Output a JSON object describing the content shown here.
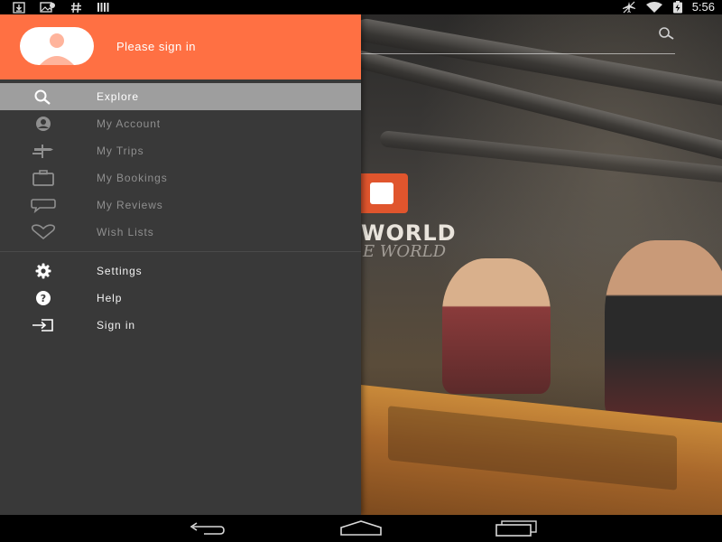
{
  "status_bar": {
    "left_icons": [
      "download-icon",
      "image-icon",
      "hash-icon",
      "barcode-icon"
    ],
    "right_icons": [
      "airplane-mode-icon",
      "wifi-icon",
      "battery-charging-icon"
    ],
    "time": "5:56"
  },
  "drawer": {
    "header": {
      "signin_prompt": "Please sign in",
      "background_color": "#ff7043"
    },
    "items": [
      {
        "label": "Explore",
        "icon": "search-icon",
        "active": true
      },
      {
        "label": "My Account",
        "icon": "account-icon",
        "active": false
      },
      {
        "label": "My Trips",
        "icon": "signpost-icon",
        "active": false
      },
      {
        "label": "My Bookings",
        "icon": "briefcase-icon",
        "active": false
      },
      {
        "label": "My Reviews",
        "icon": "speech-bubble-icon",
        "active": false
      },
      {
        "label": "Wish Lists",
        "icon": "heart-icon",
        "active": false
      }
    ],
    "secondary_items": [
      {
        "label": "Settings",
        "icon": "gear-icon"
      },
      {
        "label": "Help",
        "icon": "help-icon"
      },
      {
        "label": "Sign in",
        "icon": "sign-in-icon"
      }
    ]
  },
  "background": {
    "wall_text": "WORLD",
    "wall_text_script": "E WORLD"
  },
  "nav_bar": {
    "buttons": [
      "back-icon",
      "home-icon",
      "recents-icon"
    ]
  },
  "colors": {
    "accent": "#ff7043",
    "drawer_bg": "#393939",
    "active_item_bg": "#9e9e9e"
  }
}
